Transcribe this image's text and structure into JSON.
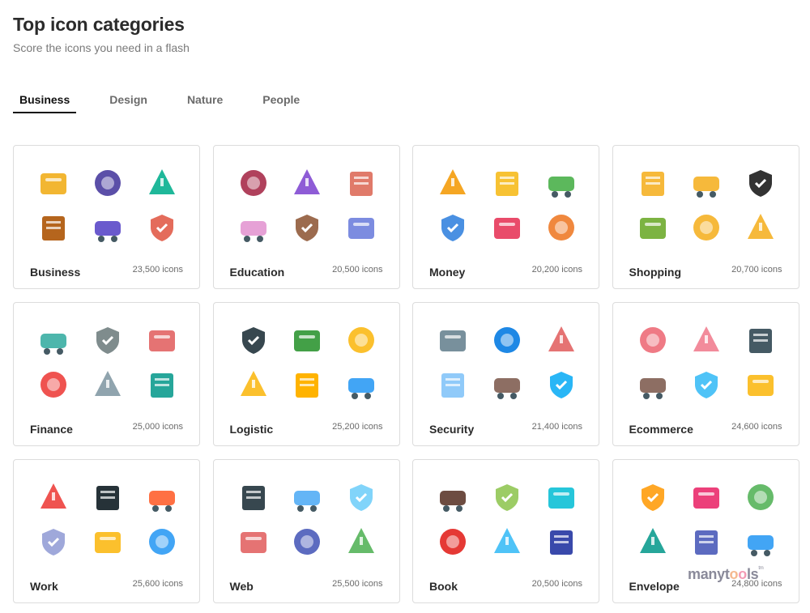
{
  "header": {
    "title": "Top icon categories",
    "subtitle": "Score the icons you need in a flash"
  },
  "tabs": [
    {
      "label": "Business",
      "active": true
    },
    {
      "label": "Design",
      "active": false
    },
    {
      "label": "Nature",
      "active": false
    },
    {
      "label": "People",
      "active": false
    }
  ],
  "categories": [
    {
      "name": "Business",
      "count": "23,500 icons",
      "icons": [
        "scales-icon",
        "calendar-clock-icon",
        "globe-icon",
        "briefcase-icon",
        "safe-icon",
        "presentation-board-icon"
      ]
    },
    {
      "name": "Education",
      "count": "20,500 icons",
      "icons": [
        "books-stack-icon",
        "pencil-case-icon",
        "backpack-icon",
        "exam-paper-icon",
        "desk-icon",
        "compass-icon"
      ]
    },
    {
      "name": "Money",
      "count": "20,200 icons",
      "icons": [
        "hands-coin-icon",
        "dollar-coin-icon",
        "protected-cash-icon",
        "currency-exchange-icon",
        "chart-decrease-icon",
        "certificate-icon"
      ]
    },
    {
      "name": "Shopping",
      "count": "20,700 icons",
      "icons": [
        "clock-badge-icon",
        "thumbs-up-badge-icon",
        "best-seller-icon",
        "eco-icon",
        "halal-icon",
        "free-delivery-truck-icon"
      ]
    },
    {
      "name": "Finance",
      "count": "25,000 icons",
      "icons": [
        "bar-chart-growth-icon",
        "team-network-icon",
        "pie-chart-icon",
        "calendar-add-icon",
        "blueprint-icon",
        "magnify-analytics-icon"
      ]
    },
    {
      "name": "Logistic",
      "count": "25,200 icons",
      "icons": [
        "credit-card-check-icon",
        "world-map-pin-icon",
        "delivery-truck-icon",
        "package-box-icon",
        "phone-24h-icon",
        "courier-icon"
      ]
    },
    {
      "name": "Security",
      "count": "21,400 icons",
      "icons": [
        "house-protection-icon",
        "clipboard-shield-icon",
        "family-protection-icon",
        "mobile-payment-icon",
        "disaster-house-icon",
        "shield-hand-icon"
      ]
    },
    {
      "name": "Ecommerce",
      "count": "24,600 icons",
      "icons": [
        "mobile-shop-icon",
        "support-headset-icon",
        "card-terminal-icon",
        "drone-delivery-icon",
        "store-24h-icon",
        "cloud-money-icon"
      ]
    },
    {
      "name": "Work",
      "count": "25,600 icons",
      "icons": [
        "warning-sign-icon",
        "officer-cap-icon",
        "traffic-cone-icon",
        "first-aid-kit-icon",
        "safety-vest-icon",
        "overalls-icon"
      ]
    },
    {
      "name": "Web",
      "count": "25,500 icons",
      "icons": [
        "laptop-transfer-icon",
        "cloud-network-icon",
        "call-cloud-icon",
        "radio-tower-icon",
        "satellite-dish-icon",
        "globe-network-icon"
      ]
    },
    {
      "name": "Book",
      "count": "20,500 icons",
      "icons": [
        "history-book-icon",
        "open-book-icon",
        "geography-book-icon",
        "apple-books-icon",
        "glasses-books-icon",
        "ebook-laptop-icon"
      ]
    },
    {
      "name": "Envelope",
      "count": "24,800 icons",
      "icons": [
        "envelope-icon",
        "email-at-icon",
        "address-book-icon",
        "mail-hierarchy-icon",
        "mail-exchange-icon",
        "certified-mail-icon"
      ]
    }
  ],
  "watermark": {
    "pre": "many",
    "t": "t",
    "o1": "o",
    "o2": "o",
    "post": "ls",
    "tm": "tm"
  }
}
